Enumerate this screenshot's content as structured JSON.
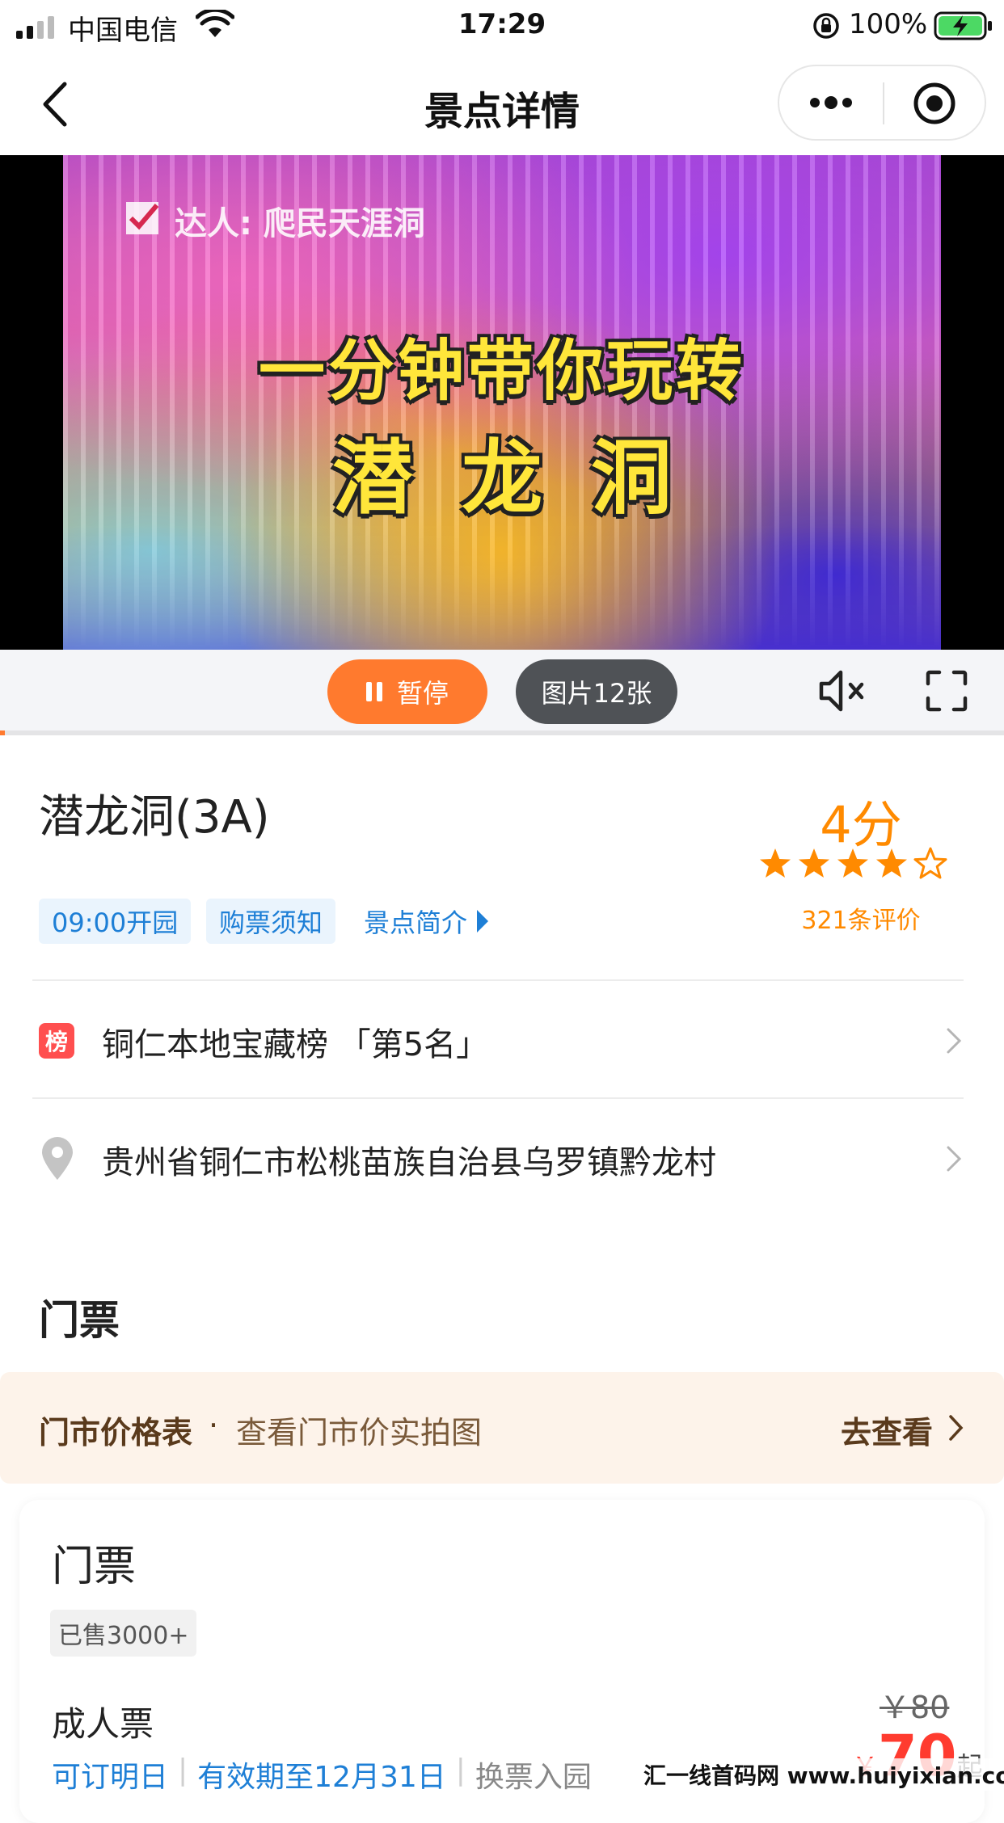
{
  "status_bar": {
    "carrier": "中国电信",
    "time": "17:29",
    "battery": "100%"
  },
  "nav": {
    "title": "景点详情"
  },
  "video": {
    "author": "达人: 爬民天涯洞",
    "caption_line1": "一分钟带你玩转",
    "caption_line2": "潜龙洞"
  },
  "media_controls": {
    "pause_label": "暂停",
    "photos_label": "图片12张",
    "progress": 0.005
  },
  "spot": {
    "name": "潜龙洞(3A)",
    "score": "4分",
    "rating": 4,
    "rating_max": 5,
    "reviews": "321条评价",
    "tags": {
      "open": "09:00开园",
      "notice": "购票须知",
      "intro": "景点简介"
    },
    "rank": {
      "badge": "榜",
      "text": "铜仁本地宝藏榜 「第5名」"
    },
    "address": "贵州省铜仁市松桃苗族自治县乌罗镇黔龙村"
  },
  "tickets": {
    "section_title": "门票",
    "price_banner": {
      "title": "门市价格表",
      "dot": "·",
      "subtitle": "查看门市价实拍图",
      "link": "去查看"
    },
    "card": {
      "title": "门票",
      "sold": "已售3000+",
      "type": "成人票",
      "original_price": "￥80",
      "currency": "￥",
      "price": "70",
      "price_suffix": "起",
      "meta": [
        "可订明日",
        "有效期至12月31日",
        "换票入园"
      ]
    }
  },
  "watermark": "汇一线首码网 www.huiyixian.com",
  "colors": {
    "accent": "#ff7a2e",
    "score": "#ff8a00",
    "link": "#1e7fd6",
    "price": "#ff3b2f",
    "rank_badge": "#ff4f4f"
  }
}
